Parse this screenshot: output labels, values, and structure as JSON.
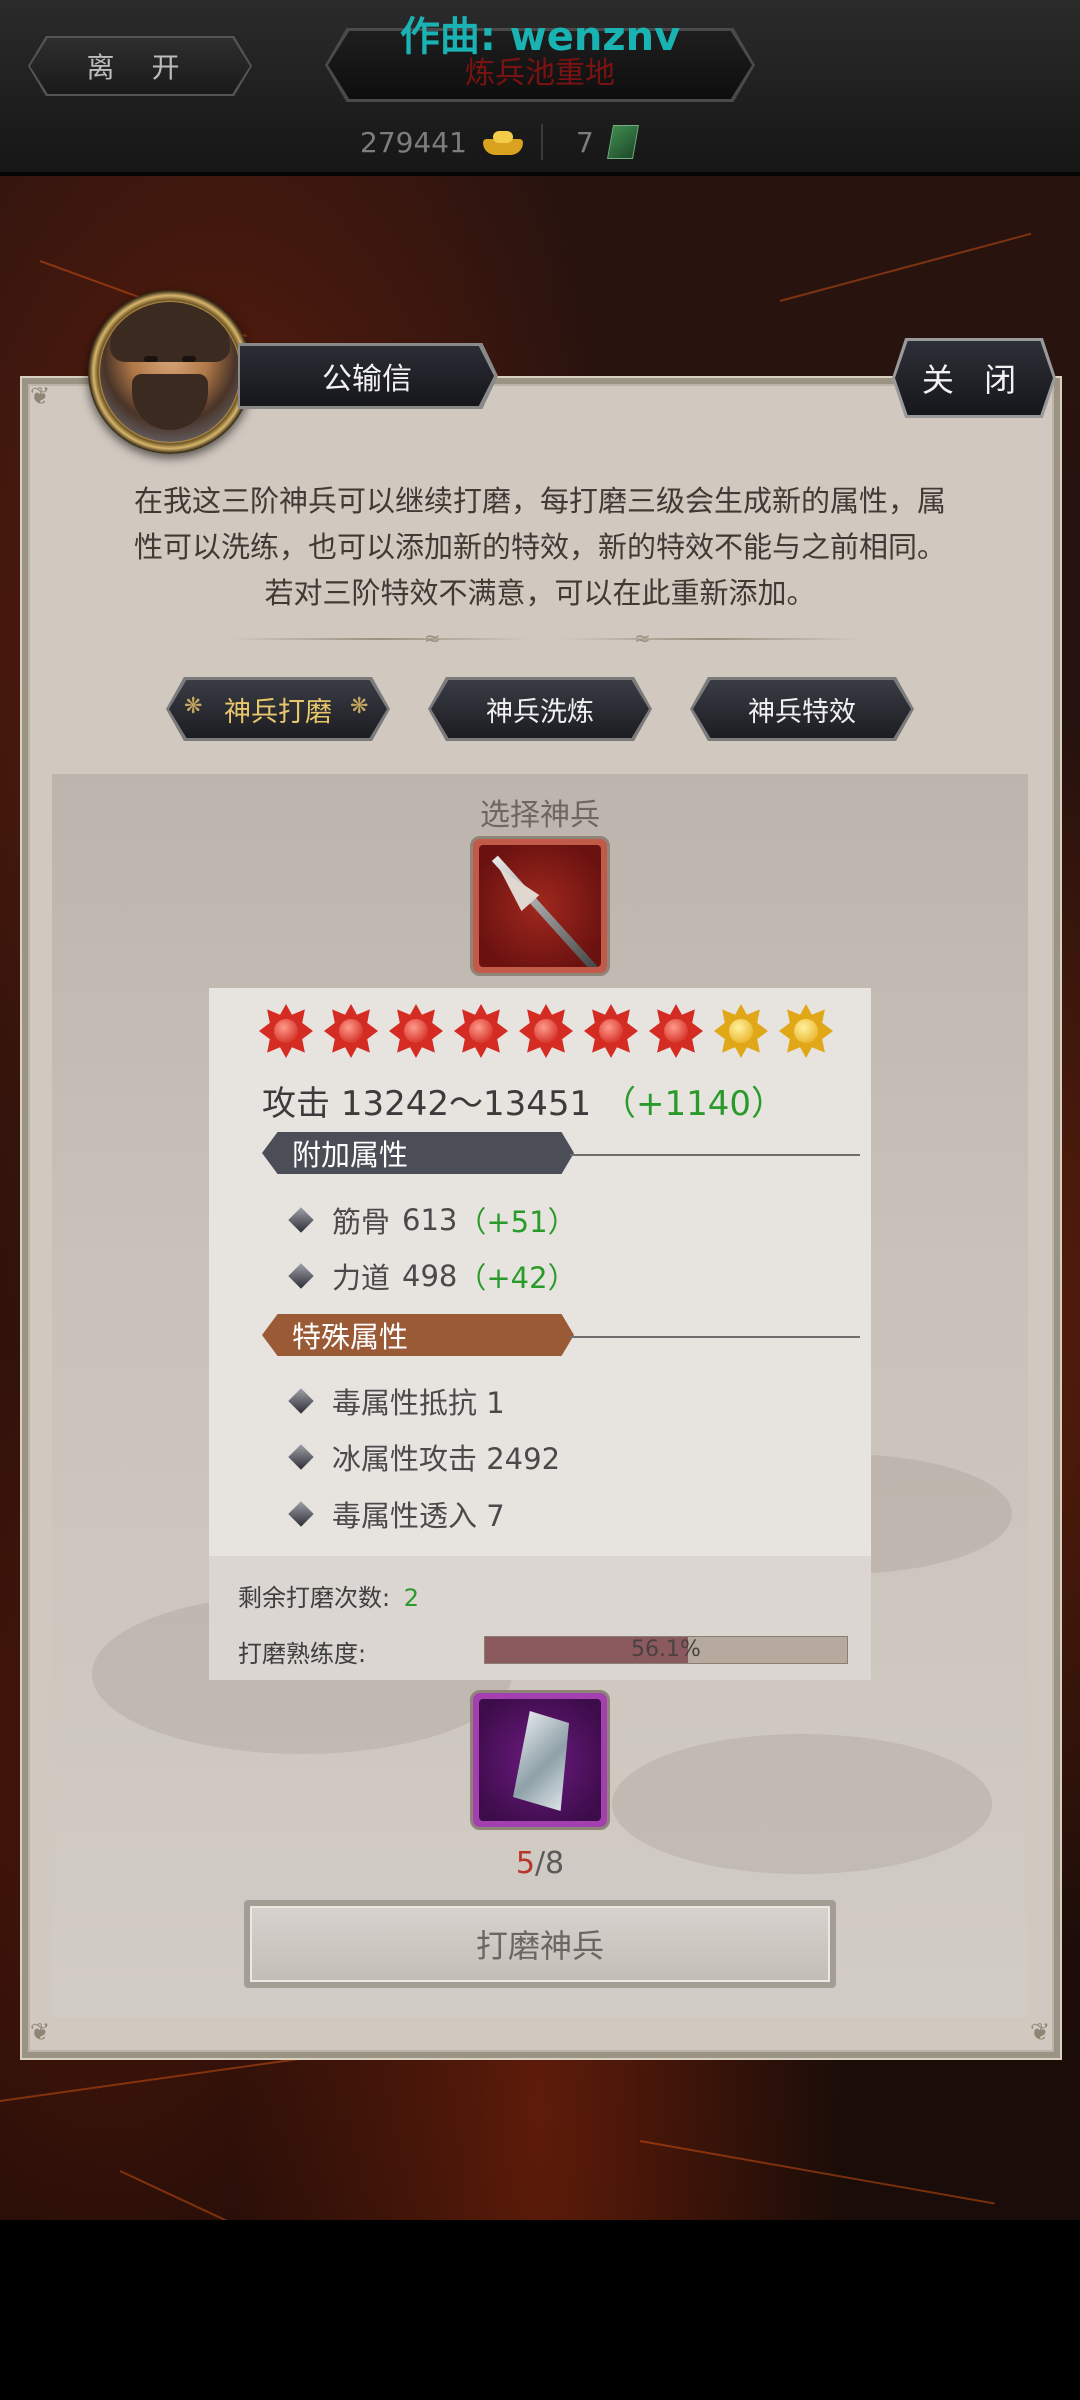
{
  "watermark": "作曲: wenznv",
  "topbar": {
    "leave_label": "离 开",
    "title": "炼兵池重地",
    "gold_amount": "279441",
    "jade_amount": "7"
  },
  "npc": {
    "name": "公输信"
  },
  "close_label": "关 闭",
  "description": {
    "line1": "在我这三阶神兵可以继续打磨，每打磨三级会生成新的属性，属",
    "line2": "性可以洗练，也可以添加新的特效，新的特效不能与之前相同。",
    "line3": "若对三阶特效不满意，可以在此重新添加。"
  },
  "tabs": [
    {
      "label": "神兵打磨",
      "active": true
    },
    {
      "label": "神兵洗炼",
      "active": false
    },
    {
      "label": "神兵特效",
      "active": false
    }
  ],
  "select_label": "选择神兵",
  "weapon": {
    "stars_red": 7,
    "stars_gold": 2,
    "attack_label": "攻击",
    "attack_range": "13242～13451",
    "attack_bonus": "（+1140）",
    "extra_section": "附加属性",
    "extra_attrs": [
      {
        "name": "筋骨",
        "value": "613",
        "bonus": "（+51）"
      },
      {
        "name": "力道",
        "value": "498",
        "bonus": "（+42）"
      }
    ],
    "special_section": "特殊属性",
    "special_attrs": [
      {
        "text": "毒属性抵抗 1"
      },
      {
        "text": "冰属性攻击 2492"
      },
      {
        "text": "毒属性透入 7"
      }
    ]
  },
  "remaining_label": "剩余打磨次数:",
  "remaining_value": "2",
  "proficiency_label": "打磨熟练度:",
  "proficiency_value": 0.561,
  "proficiency_text": "56.1%",
  "material": {
    "have": "5",
    "need": "/8"
  },
  "action_label": "打磨神兵",
  "colors": {
    "attr_section": "#4b4d57",
    "special_section": "#9b5a36",
    "bonus_green": "#2a9a2a"
  }
}
